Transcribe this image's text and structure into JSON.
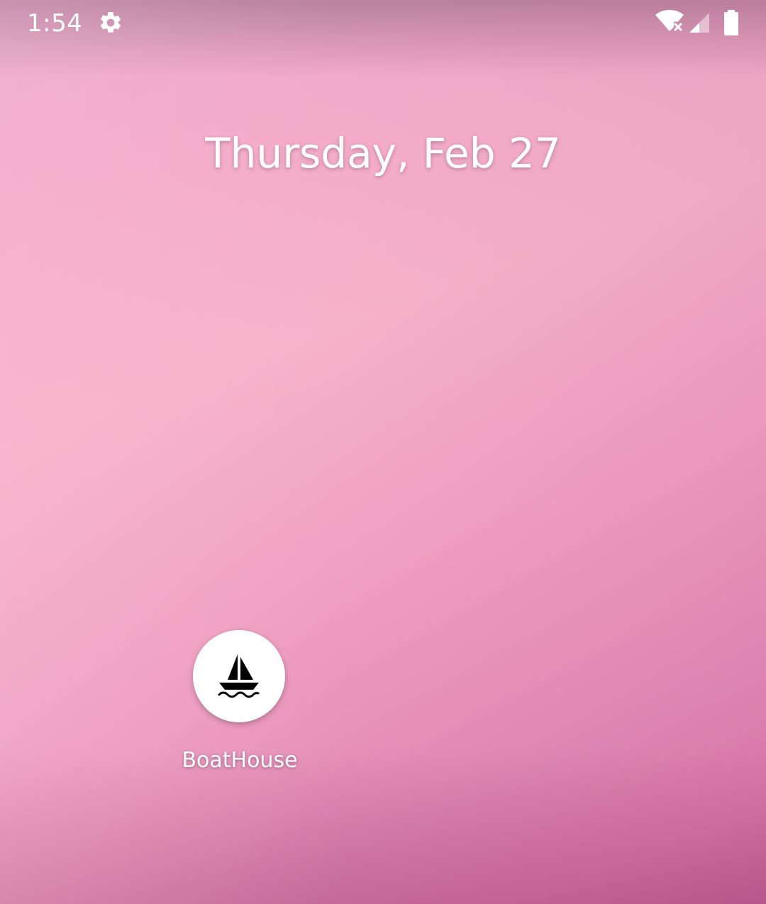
{
  "status_bar": {
    "time": "1:54",
    "icons": [
      "gear-icon",
      "wifi-no-internet-icon",
      "cell-signal-icon",
      "battery-full-icon"
    ]
  },
  "home": {
    "date": "Thursday, Feb 27"
  },
  "apps": [
    {
      "label": "BoatHouse",
      "icon": "sailboat-icon"
    }
  ],
  "colors": {
    "icon_background": "#ffffff",
    "text": "#ffffff",
    "wallpaper_accent": "#f3aac8"
  }
}
